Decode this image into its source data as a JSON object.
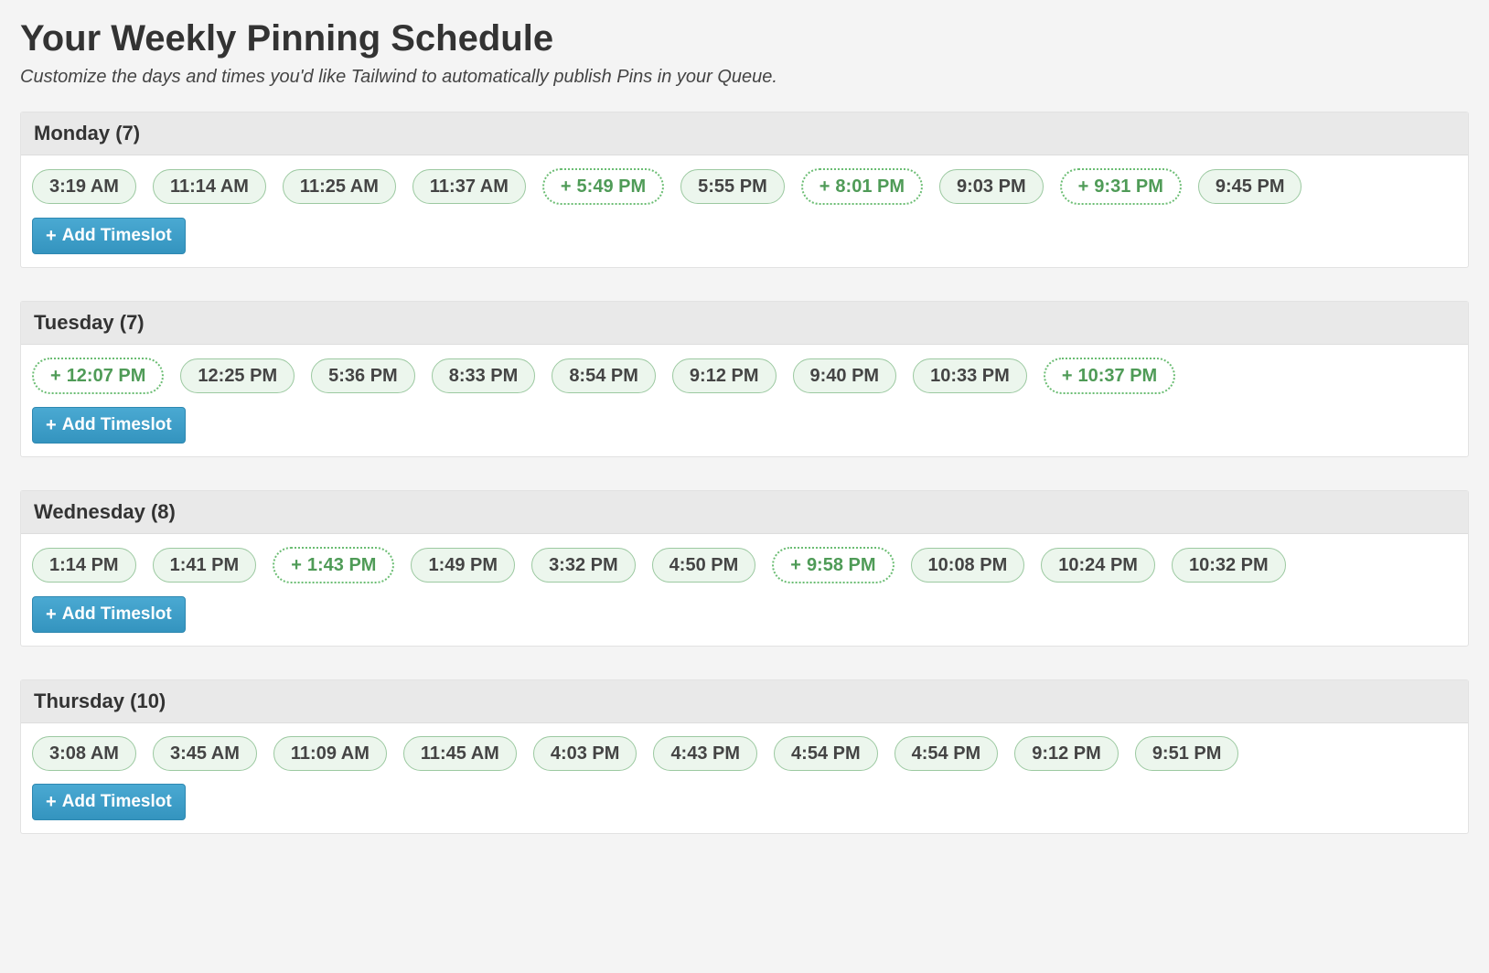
{
  "page": {
    "title": "Your Weekly Pinning Schedule",
    "subtitle": "Customize the days and times you'd like Tailwind to automatically publish Pins in your Queue."
  },
  "add_button_label": "Add Timeslot",
  "days": [
    {
      "name": "Monday",
      "count": 7,
      "header": "Monday (7)",
      "slots": [
        {
          "time": "3:19 AM",
          "suggested": false
        },
        {
          "time": "11:14 AM",
          "suggested": false
        },
        {
          "time": "11:25 AM",
          "suggested": false
        },
        {
          "time": "11:37 AM",
          "suggested": false
        },
        {
          "time": "5:49 PM",
          "suggested": true
        },
        {
          "time": "5:55 PM",
          "suggested": false
        },
        {
          "time": "8:01 PM",
          "suggested": true
        },
        {
          "time": "9:03 PM",
          "suggested": false
        },
        {
          "time": "9:31 PM",
          "suggested": true
        },
        {
          "time": "9:45 PM",
          "suggested": false
        }
      ]
    },
    {
      "name": "Tuesday",
      "count": 7,
      "header": "Tuesday (7)",
      "slots": [
        {
          "time": "12:07 PM",
          "suggested": true
        },
        {
          "time": "12:25 PM",
          "suggested": false
        },
        {
          "time": "5:36 PM",
          "suggested": false
        },
        {
          "time": "8:33 PM",
          "suggested": false
        },
        {
          "time": "8:54 PM",
          "suggested": false
        },
        {
          "time": "9:12 PM",
          "suggested": false
        },
        {
          "time": "9:40 PM",
          "suggested": false
        },
        {
          "time": "10:33 PM",
          "suggested": false
        },
        {
          "time": "10:37 PM",
          "suggested": true
        }
      ]
    },
    {
      "name": "Wednesday",
      "count": 8,
      "header": "Wednesday (8)",
      "slots": [
        {
          "time": "1:14 PM",
          "suggested": false
        },
        {
          "time": "1:41 PM",
          "suggested": false
        },
        {
          "time": "1:43 PM",
          "suggested": true
        },
        {
          "time": "1:49 PM",
          "suggested": false
        },
        {
          "time": "3:32 PM",
          "suggested": false
        },
        {
          "time": "4:50 PM",
          "suggested": false
        },
        {
          "time": "9:58 PM",
          "suggested": true
        },
        {
          "time": "10:08 PM",
          "suggested": false
        },
        {
          "time": "10:24 PM",
          "suggested": false
        },
        {
          "time": "10:32 PM",
          "suggested": false
        }
      ]
    },
    {
      "name": "Thursday",
      "count": 10,
      "header": "Thursday (10)",
      "slots": [
        {
          "time": "3:08 AM",
          "suggested": false
        },
        {
          "time": "3:45 AM",
          "suggested": false
        },
        {
          "time": "11:09 AM",
          "suggested": false
        },
        {
          "time": "11:45 AM",
          "suggested": false
        },
        {
          "time": "4:03 PM",
          "suggested": false
        },
        {
          "time": "4:43 PM",
          "suggested": false
        },
        {
          "time": "4:54 PM",
          "suggested": false
        },
        {
          "time": "4:54 PM",
          "suggested": false
        },
        {
          "time": "9:12 PM",
          "suggested": false
        },
        {
          "time": "9:51 PM",
          "suggested": false
        }
      ]
    }
  ]
}
